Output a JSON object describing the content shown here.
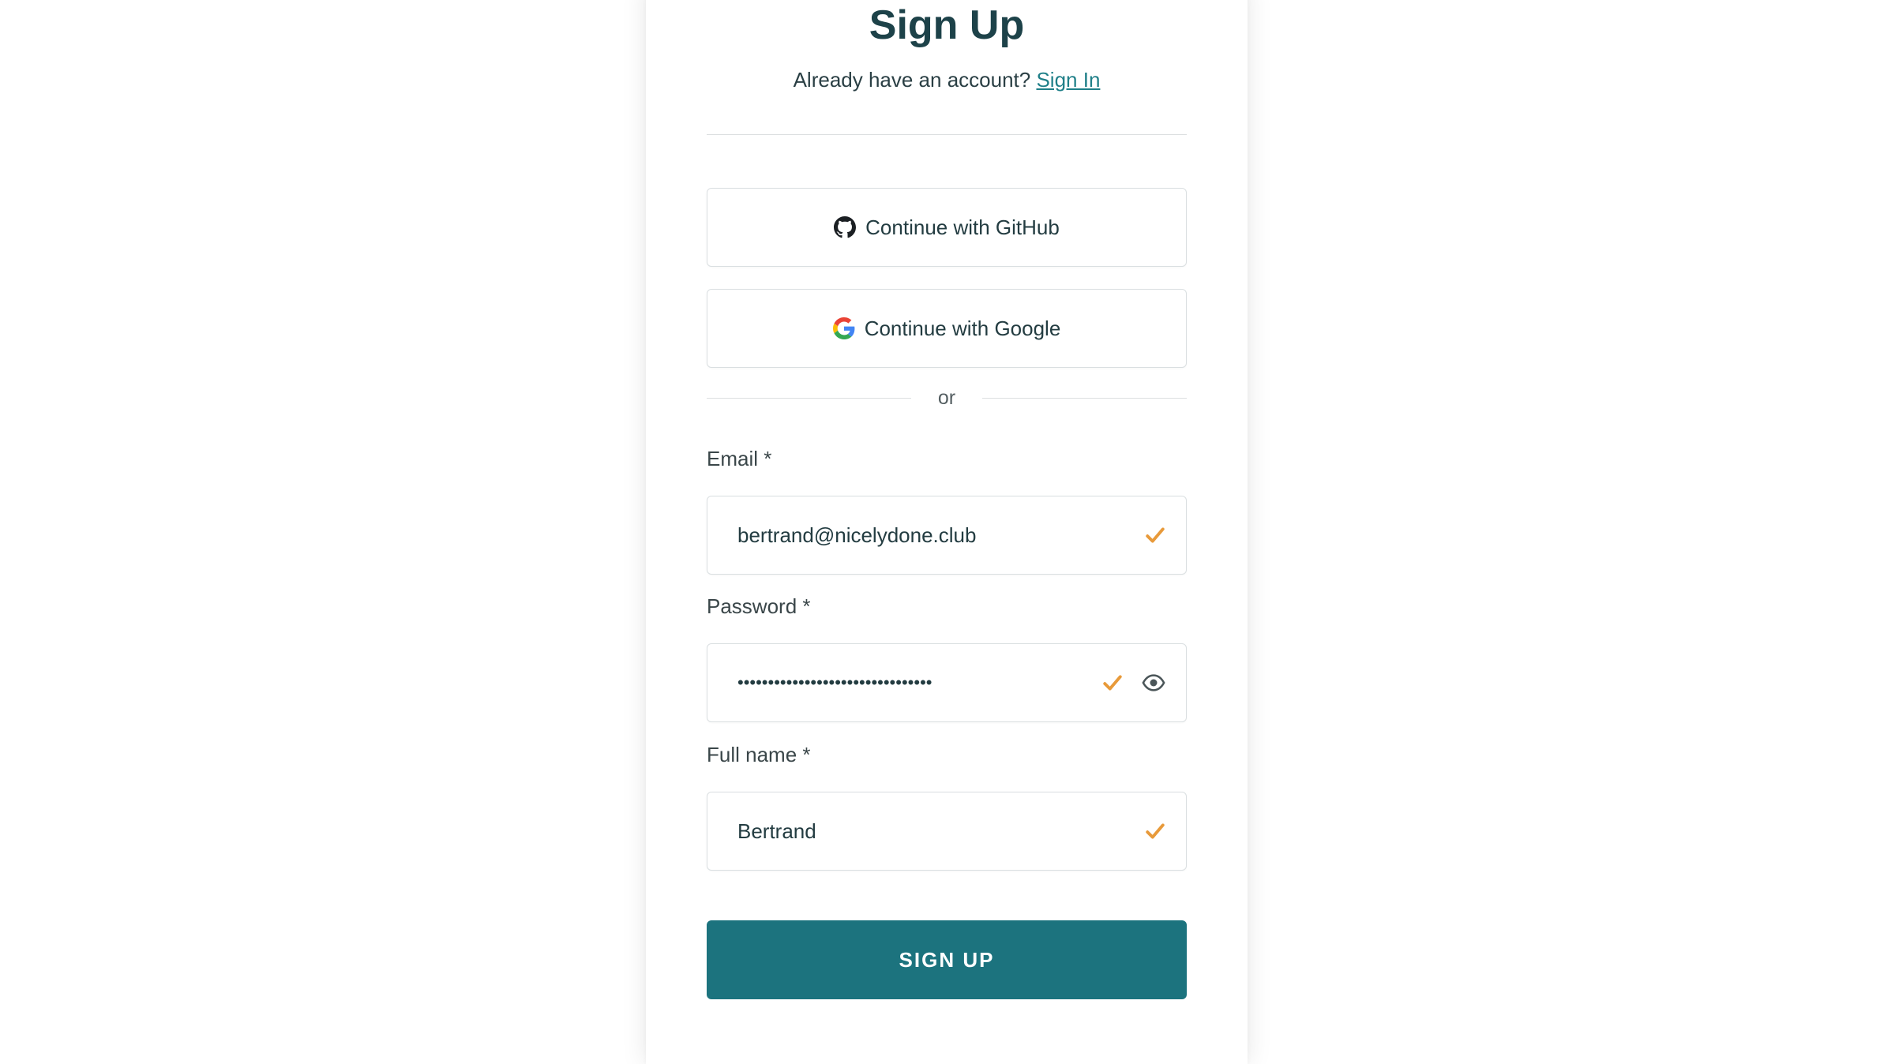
{
  "header": {
    "title": "Sign Up",
    "account_prompt": "Already have an account?",
    "sign_in_link": "Sign In"
  },
  "oauth": {
    "github_label": "Continue with GitHub",
    "google_label": "Continue with Google"
  },
  "divider": {
    "or_text": "or"
  },
  "form": {
    "email": {
      "label": "Email *",
      "value": "bertrand@nicelydone.club",
      "valid": true
    },
    "password": {
      "label": "Password *",
      "value": "••••••••••••••••••••••••••••••••",
      "valid": true
    },
    "full_name": {
      "label": "Full name *",
      "value": "Bertrand",
      "valid": true
    },
    "submit_label": "SIGN UP"
  },
  "colors": {
    "primary": "#1c737e",
    "link": "#1f7f88",
    "check": "#e89a3a",
    "heading": "#1d4249"
  },
  "icons": {
    "github": "github-icon",
    "google": "google-icon",
    "check": "checkmark-icon",
    "eye": "eye-icon"
  }
}
